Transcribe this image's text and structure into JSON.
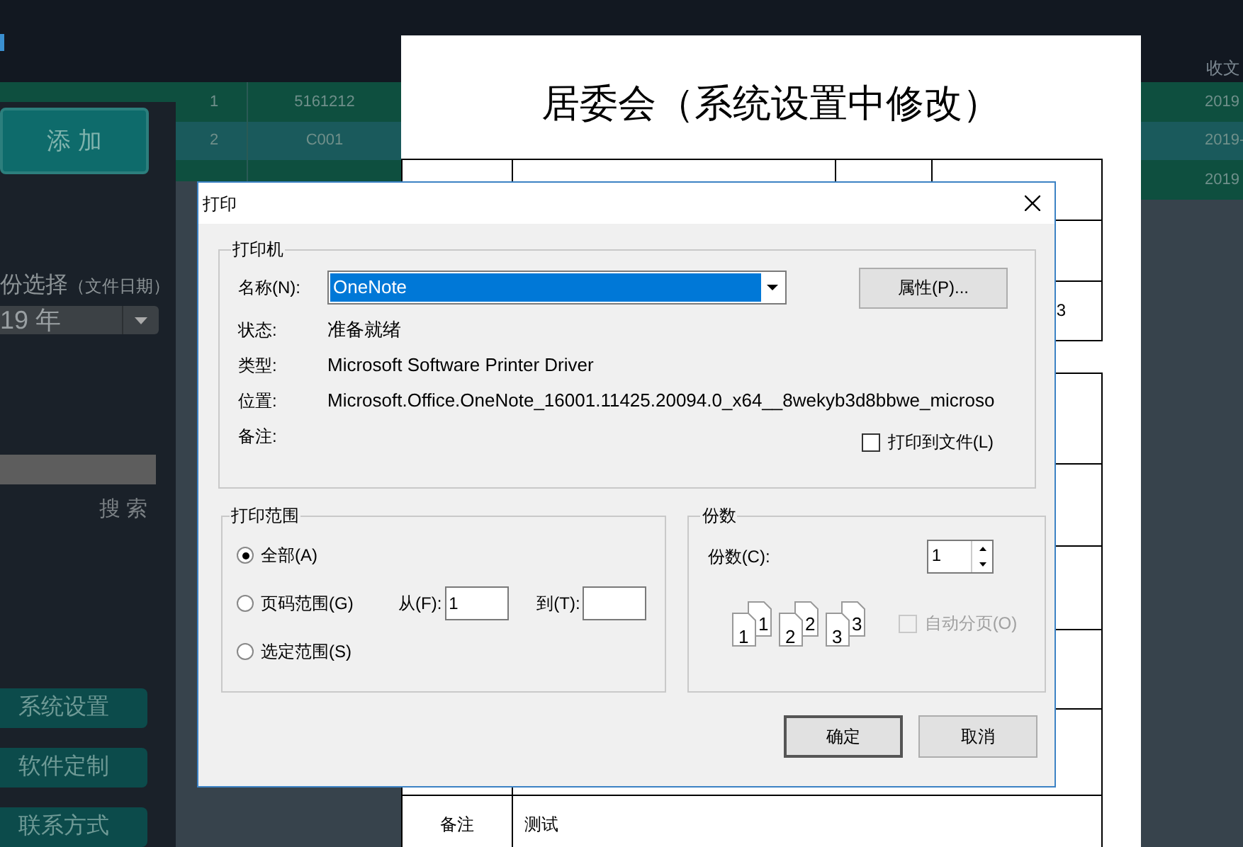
{
  "app": {
    "add_button": "添 加",
    "year_label": "份选择",
    "year_hint": "（文件日期）",
    "year_value": "19 年",
    "search_button": "搜 索",
    "nav": [
      "系统设置",
      "软件定制",
      "联系方式"
    ],
    "table": {
      "header": "收文",
      "rows": [
        {
          "index": "1",
          "code": "5161212",
          "date": "2019",
          "selected": false
        },
        {
          "index": "2",
          "code": "C001",
          "date": "2019-",
          "selected": true
        },
        {
          "date": "2019",
          "selected": false
        }
      ]
    }
  },
  "preview": {
    "title": "居委会（系统设置中修改）",
    "top_table_value": "3",
    "remarks_label": "备注",
    "remarks_value": "测试"
  },
  "dialog": {
    "title": "打印",
    "printer": {
      "legend": "打印机",
      "name_label": "名称(N):",
      "name_value": "OneNote",
      "properties_button": "属性(P)...",
      "info": [
        {
          "label": "状态:",
          "value": "准备就绪"
        },
        {
          "label": "类型:",
          "value": "Microsoft Software Printer Driver"
        },
        {
          "label": "位置:",
          "value": "Microsoft.Office.OneNote_16001.11425.20094.0_x64__8wekyb3d8bbwe_microso"
        },
        {
          "label": "备注:"
        }
      ],
      "print_to_file": {
        "label": "打印到文件(L)",
        "checked": false
      }
    },
    "range": {
      "legend": "打印范围",
      "options": [
        {
          "label": "全部(A)",
          "selected": true
        },
        {
          "label": "页码范围(G)",
          "selected": false
        },
        {
          "label": "选定范围(S)",
          "selected": false
        }
      ],
      "from": {
        "label": "从(F):",
        "value": "1"
      },
      "to": {
        "label": "到(T):"
      }
    },
    "copies": {
      "legend": "份数",
      "label": "份数(C):",
      "value": "1",
      "collate_pages": [
        {
          "back": "1",
          "front": "1"
        },
        {
          "back": "2",
          "front": "2"
        },
        {
          "back": "3",
          "front": "3"
        }
      ],
      "collate": {
        "label": "自动分页(O)",
        "checked": false,
        "disabled": true
      }
    },
    "buttons": [
      {
        "label": "确定",
        "default": true
      },
      {
        "label": "取消",
        "default": false
      }
    ]
  }
}
